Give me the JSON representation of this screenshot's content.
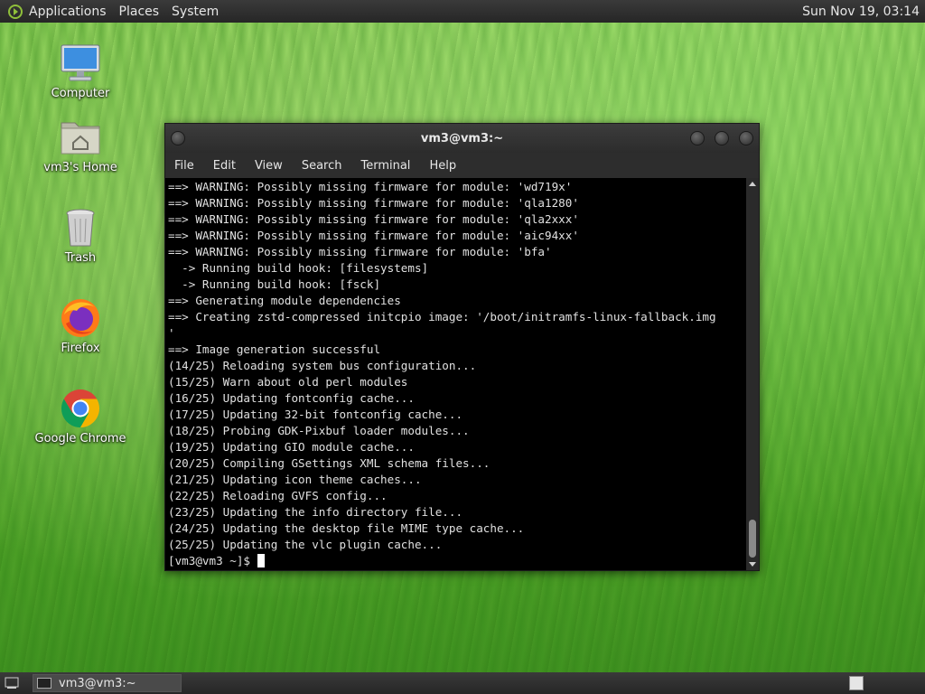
{
  "top_panel": {
    "menus": [
      "Applications",
      "Places",
      "System"
    ],
    "clock": "Sun Nov 19, 03:14"
  },
  "desktop_icons": [
    {
      "label": "Computer",
      "icon": "computer-icon"
    },
    {
      "label": "vm3's Home",
      "icon": "home-folder-icon"
    },
    {
      "label": "Trash",
      "icon": "trash-icon"
    },
    {
      "label": "Firefox",
      "icon": "firefox-icon"
    },
    {
      "label": "Google Chrome",
      "icon": "chrome-icon"
    }
  ],
  "terminal": {
    "title": "vm3@vm3:~",
    "menu": [
      "File",
      "Edit",
      "View",
      "Search",
      "Terminal",
      "Help"
    ],
    "lines": [
      "==> WARNING: Possibly missing firmware for module: 'wd719x'",
      "==> WARNING: Possibly missing firmware for module: 'qla1280'",
      "==> WARNING: Possibly missing firmware for module: 'qla2xxx'",
      "==> WARNING: Possibly missing firmware for module: 'aic94xx'",
      "==> WARNING: Possibly missing firmware for module: 'bfa'",
      "  -> Running build hook: [filesystems]",
      "  -> Running build hook: [fsck]",
      "==> Generating module dependencies",
      "==> Creating zstd-compressed initcpio image: '/boot/initramfs-linux-fallback.img",
      "'",
      "==> Image generation successful",
      "(14/25) Reloading system bus configuration...",
      "(15/25) Warn about old perl modules",
      "(16/25) Updating fontconfig cache...",
      "(17/25) Updating 32-bit fontconfig cache...",
      "(18/25) Probing GDK-Pixbuf loader modules...",
      "(19/25) Updating GIO module cache...",
      "(20/25) Compiling GSettings XML schema files...",
      "(21/25) Updating icon theme caches...",
      "(22/25) Reloading GVFS config...",
      "(23/25) Updating the info directory file...",
      "(24/25) Updating the desktop file MIME type cache...",
      "(25/25) Updating the vlc plugin cache..."
    ],
    "prompt": "[vm3@vm3 ~]$ "
  },
  "taskbar": {
    "task_label": "vm3@vm3:~"
  }
}
